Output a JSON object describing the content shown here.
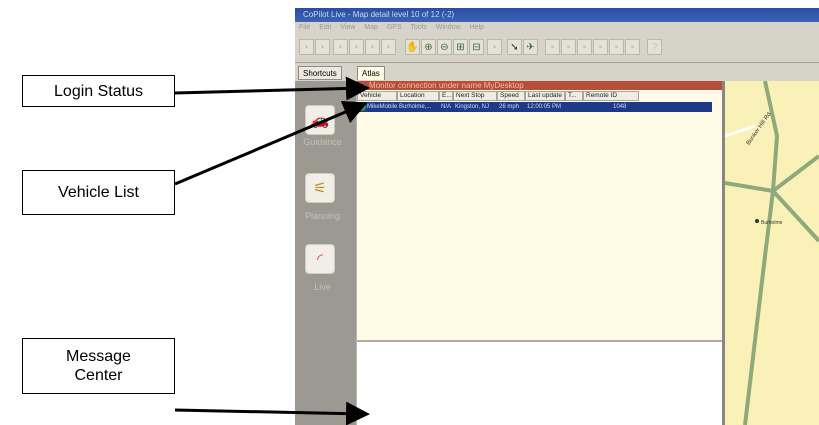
{
  "callouts": {
    "login_status": "Login Status",
    "vehicle_list": "Vehicle List",
    "message_center": "Message Center"
  },
  "window": {
    "title": "CoPilot Live - Map detail level 10 of 12 (-2)",
    "menu": [
      "File",
      "Edit",
      "View",
      "Map",
      "GPS",
      "Tools",
      "Window",
      "Help"
    ]
  },
  "tabs": {
    "shortcuts": "Shortcuts",
    "atlas": "Atlas"
  },
  "sidebar": {
    "items": [
      {
        "label": "Guidance",
        "icon": "car-icon"
      },
      {
        "label": "Planning",
        "icon": "route-icon"
      },
      {
        "label": "Live",
        "icon": "signal-icon"
      }
    ]
  },
  "status": {
    "text": "Monitor connection under name MyDesktop"
  },
  "vehicle_table": {
    "columns": [
      "Vehicle",
      "Location",
      "E...",
      "Next Stop",
      "Speed",
      "Last update",
      "T...",
      "Remote ID"
    ],
    "rows": [
      [
        "MikeMobile",
        "Burholme,...",
        "N/A",
        "Kingston, NJ",
        "26 mph",
        "12:00:05 PM",
        "",
        "1048"
      ]
    ]
  },
  "map": {
    "road_label": "Bunker Hill Rd",
    "place_label": "Burholme"
  },
  "colors": {
    "status_bar": "#b44f3a",
    "selected_row": "#1d3a8a",
    "map_bg": "#faf1b8",
    "road": "#8faa7a"
  }
}
